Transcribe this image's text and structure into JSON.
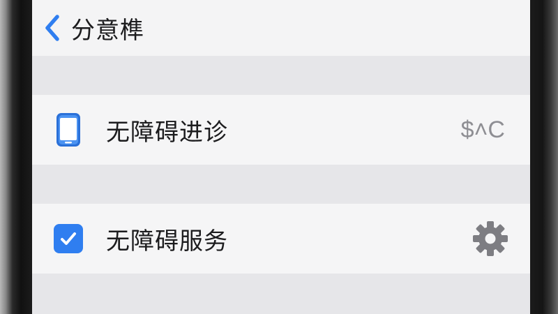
{
  "nav": {
    "title": "分意榫",
    "back_icon": "chevron-left-icon"
  },
  "rows": [
    {
      "icon": "phone-icon",
      "label": "无障碍进诊",
      "value": "$˄C"
    },
    {
      "icon": "checkbox-checked-icon",
      "label": "无障碍服务",
      "checked": true,
      "trailing_icon": "gear-icon"
    }
  ],
  "colors": {
    "accent": "#2f7ef0",
    "background": "#ebebed",
    "row_background": "#f5f5f6",
    "text": "#1c1c1e",
    "secondary_text": "#8e8e93",
    "gear": "#7d7d82"
  }
}
